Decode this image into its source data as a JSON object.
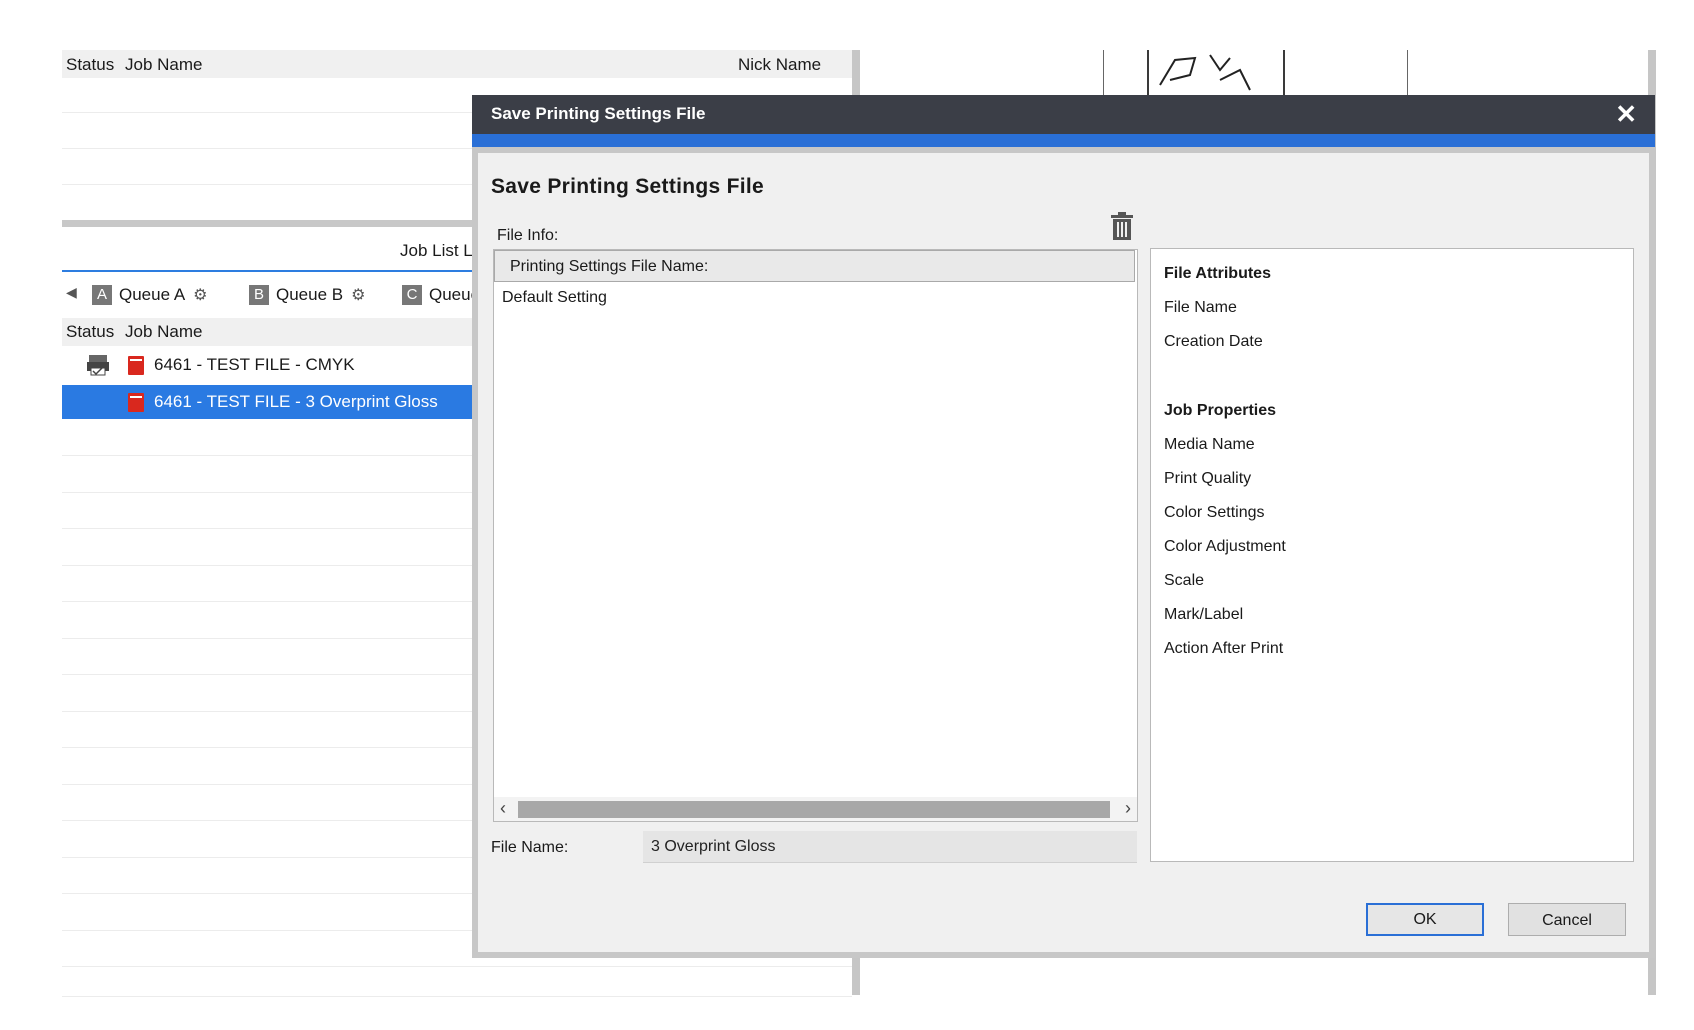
{
  "upper_list": {
    "col_status": "Status",
    "col_job_name": "Job Name",
    "col_nick_name": "Nick Name"
  },
  "job_list": {
    "title_fragment": "Job List LC",
    "tabs": [
      {
        "letter": "A",
        "label": "Queue A"
      },
      {
        "letter": "B",
        "label": "Queue B"
      },
      {
        "letter": "C",
        "label": "Queue"
      }
    ],
    "col_status": "Status",
    "col_job_name": "Job Name",
    "rows": [
      {
        "name": "6461 - TEST FILE - CMYK",
        "selected": false
      },
      {
        "name": "6461 - TEST FILE - 3 Overprint Gloss",
        "selected": true
      }
    ]
  },
  "dialog": {
    "window_title": "Save Printing Settings File",
    "close_icon": "close-icon",
    "heading": "Save Printing Settings File",
    "file_info_label": "File Info:",
    "delete_icon": "trash-icon",
    "list_header": "Printing Settings File Name:",
    "list_items": [
      "Default Setting"
    ],
    "file_name_label": "File Name:",
    "file_name_value": "3 Overprint Gloss",
    "attributes": {
      "section1": "File Attributes",
      "section1_items": [
        "File Name",
        "Creation Date"
      ],
      "section2": "Job Properties",
      "section2_items": [
        "Media Name",
        "Print Quality",
        "Color Settings",
        "Color Adjustment",
        "Scale",
        "Mark/Label",
        "Action After Print"
      ]
    },
    "ok_label": "OK",
    "cancel_label": "Cancel"
  },
  "colors": {
    "title_bar": "#3b3e47",
    "accent": "#2a6fd6",
    "selection": "#2a7ae2",
    "pdf_icon": "#d9281e"
  }
}
